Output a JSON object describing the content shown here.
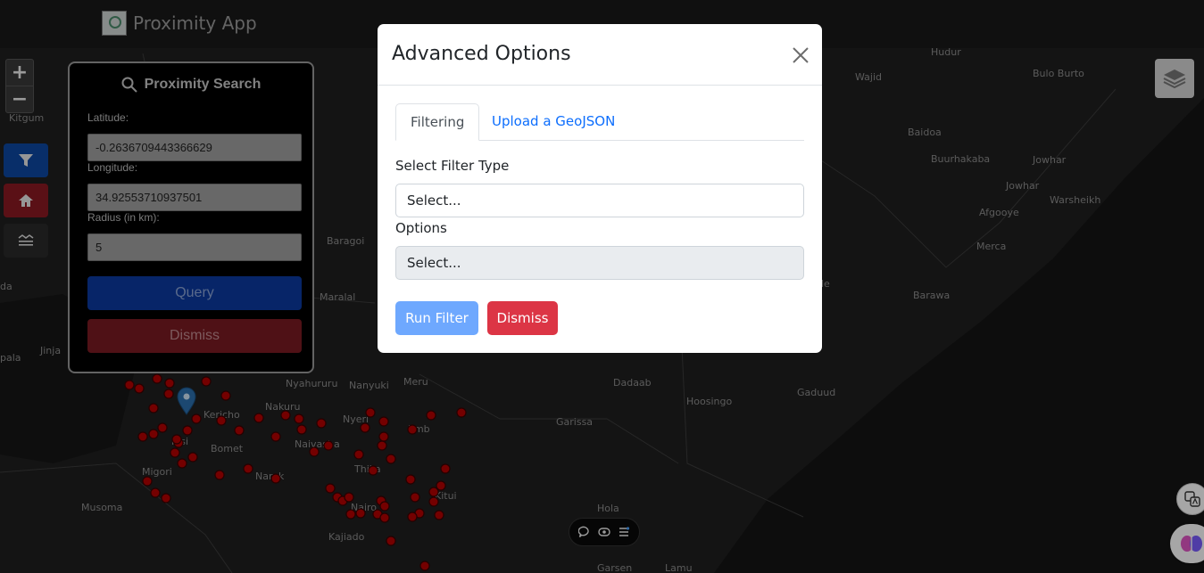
{
  "app": {
    "title": "Proximity App"
  },
  "map": {
    "labels": [
      "Hudur",
      "Wajid",
      "Bulo Burto",
      "Kitgum",
      "Baidoa",
      "Buurhakaba",
      "Jowhar",
      "Jowhar",
      "Warsheikh",
      "Afgooye",
      "Baragoi",
      "Merca",
      "Maralal",
      "da",
      "Barawa",
      "Jinja",
      "pala",
      "Nyahururu",
      "Nanyuki",
      "Meru",
      "Dadaab",
      "Hoosingo",
      "Gaduud",
      "Kericho",
      "Nakuru",
      "Nyeri",
      "Garissa",
      "Kisi",
      "Bomet",
      "Naivasha",
      "Emb",
      "Migori",
      "Narok",
      "Thika",
      "Musoma",
      "Nairo",
      "Kitui",
      "Hola",
      "Kajiado",
      "Garsen",
      "Lamu",
      "le"
    ],
    "pin_color": "#2b6fae",
    "marker_color": "#b20000"
  },
  "map_controls": {
    "zoom_in": "+",
    "zoom_out": "−"
  },
  "side_buttons": [
    {
      "icon": "filter-icon",
      "color": "#0d47a1"
    },
    {
      "icon": "home-icon",
      "color": "#8b1a22"
    },
    {
      "icon": "layers-list-icon",
      "color": "#2a2a2a"
    }
  ],
  "proximity": {
    "title": "Proximity Search",
    "latitude_label": "Latitude:",
    "latitude_value": "-0.2636709443366629",
    "longitude_label": "Longitude:",
    "longitude_value": "34.92553710937501",
    "radius_label": "Radius (in km):",
    "radius_value": "5",
    "query_label": "Query",
    "dismiss_label": "Dismiss"
  },
  "modal": {
    "title": "Advanced Options",
    "tabs": [
      "Filtering",
      "Upload a GeoJSON"
    ],
    "filter_type_label": "Select Filter Type",
    "filter_type_placeholder": "Select...",
    "options_label": "Options",
    "options_placeholder": "Select...",
    "run_filter_label": "Run Filter",
    "dismiss_label": "Dismiss"
  },
  "colors": {
    "primary": "#0d6efd",
    "danger": "#dc3545",
    "run_filter": "#6ea8fe"
  }
}
